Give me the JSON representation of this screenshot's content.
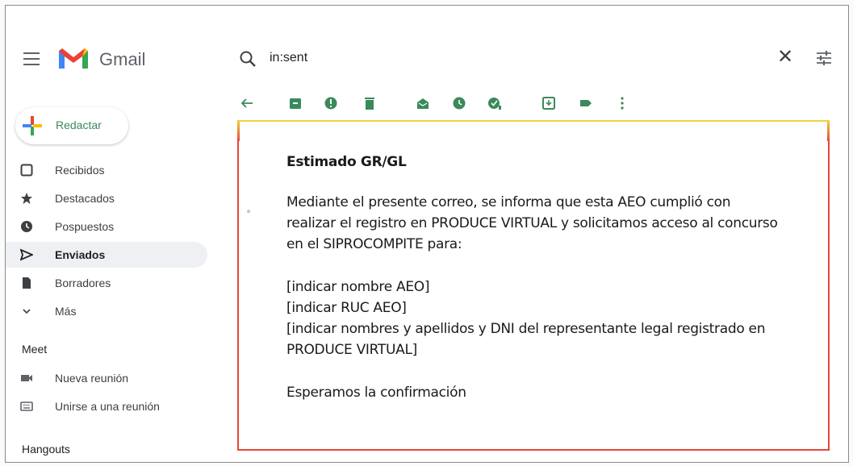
{
  "app": {
    "name": "Gmail"
  },
  "search": {
    "value": "in:sent"
  },
  "compose": {
    "label": "Redactar"
  },
  "sidebar": {
    "items": [
      {
        "label": "Recibidos",
        "icon": "inbox-icon"
      },
      {
        "label": "Destacados",
        "icon": "star-icon"
      },
      {
        "label": "Pospuestos",
        "icon": "clock-icon"
      },
      {
        "label": "Enviados",
        "icon": "send-icon",
        "active": true
      },
      {
        "label": "Borradores",
        "icon": "draft-icon"
      },
      {
        "label": "Más",
        "icon": "chevron-down-icon"
      }
    ],
    "meet_title": "Meet",
    "meet_items": [
      {
        "label": "Nueva reunión",
        "icon": "video-icon"
      },
      {
        "label": "Unirse a una reunión",
        "icon": "keyboard-icon"
      }
    ],
    "hangouts_title": "Hangouts"
  },
  "toolbar": {
    "icons": [
      "back-arrow-icon",
      "archive-icon",
      "report-spam-icon",
      "delete-icon",
      "mark-unread-icon",
      "snooze-icon",
      "add-task-icon",
      "move-to-icon",
      "label-icon",
      "more-vert-icon"
    ]
  },
  "email": {
    "greeting": "Estimado GR/GL",
    "para1_line1": "Mediante el presente correo, se informa que esta AEO cumplió con",
    "para1_line2": "realizar el registro en PRODUCE VIRTUAL y solicitamos acceso al concurso",
    "para1_line3": "en el SIPROCOMPITE para:",
    "item1": "[indicar nombre AEO]",
    "item2": "[indicar RUC AEO]",
    "item3_line1": "[indicar nombres y apellidos y DNI del representante legal registrado en",
    "item3_line2": "PRODUCE VIRTUAL]",
    "closing": "Esperamos la confirmación"
  },
  "colors": {
    "accent_green": "#3a8a5c",
    "box_border_red": "#e8463a",
    "box_border_yellow": "#f0d33a"
  }
}
